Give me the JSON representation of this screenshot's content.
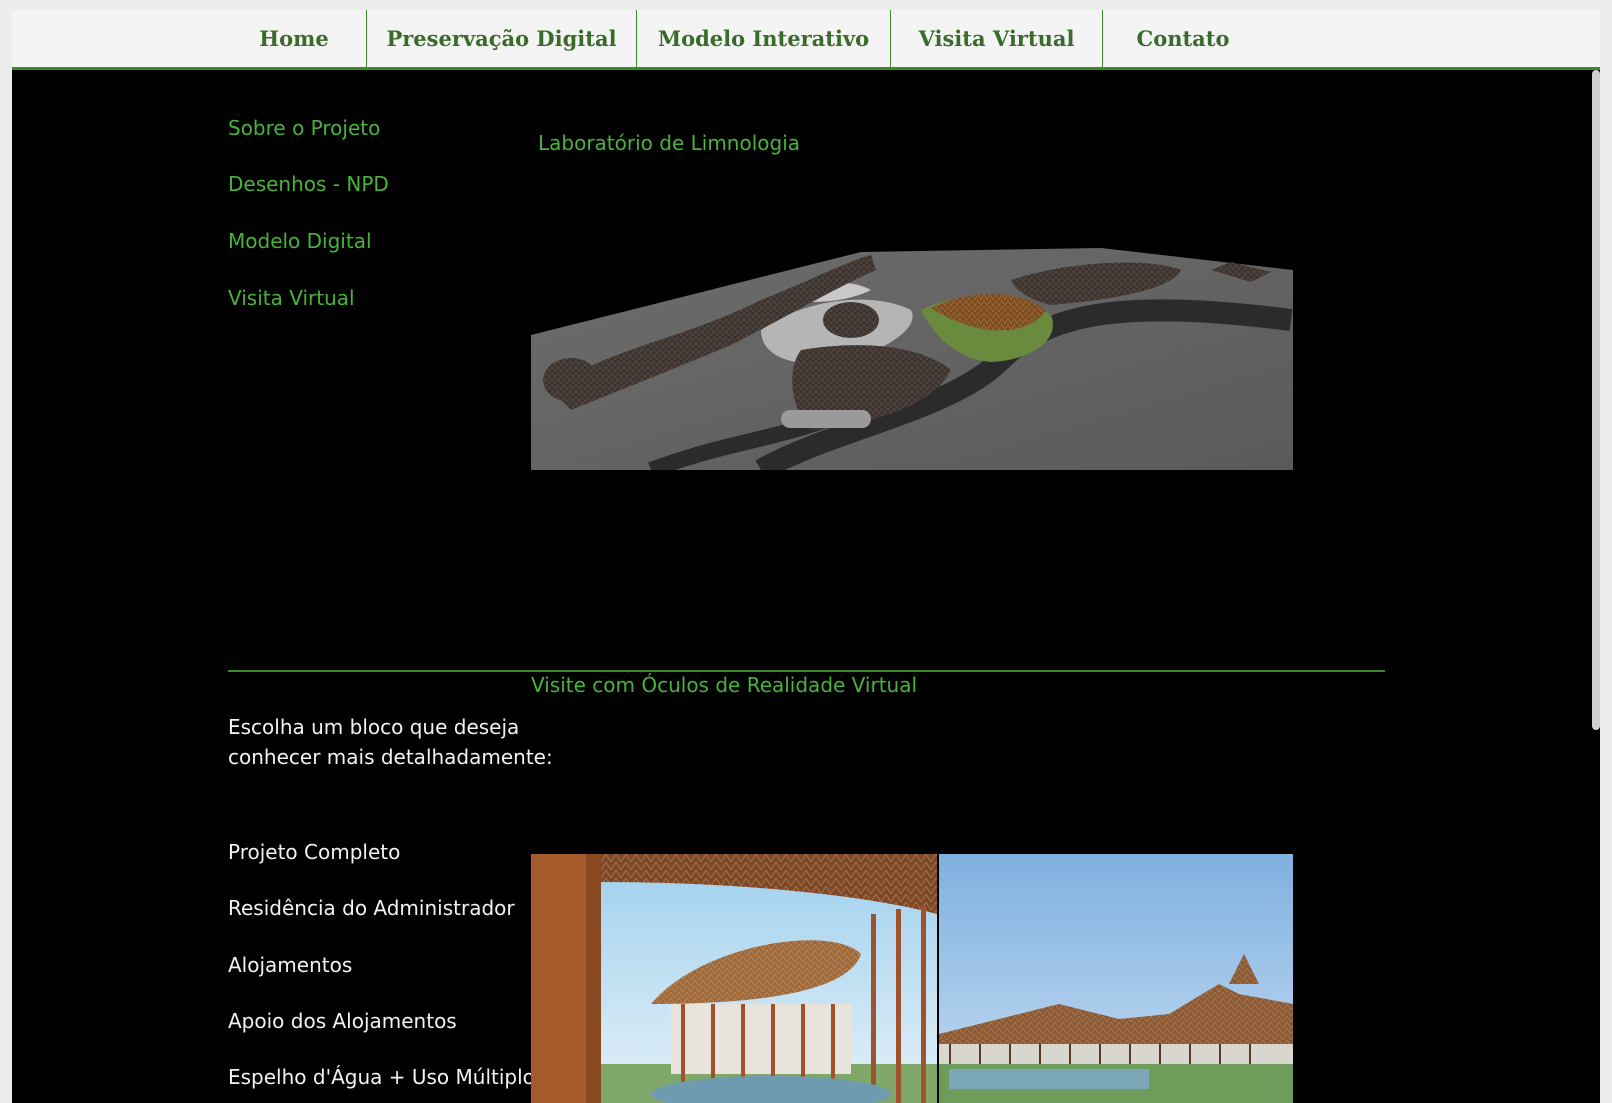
{
  "nav": {
    "items": [
      "Home",
      "Preservação Digital",
      "Modelo Interativo",
      "Visita Virtual",
      "Contato"
    ]
  },
  "sidebar": {
    "links": [
      "Sobre o Projeto",
      "Desenhos - NPD",
      "Modelo Digital",
      "Visita Virtual"
    ]
  },
  "main": {
    "title": "Laboratório de Limnologia",
    "vr_title": "Visite com Óculos de Realidade Virtual",
    "prompt_line1": "Escolha um bloco que deseja",
    "prompt_line2": "conhecer mais detalhadamente:"
  },
  "blocks": {
    "items": [
      "Projeto Completo",
      "Residência do Administrador",
      "Alojamentos",
      "Apoio dos Alojamentos",
      "Espelho d'Água + Uso Múltiplo"
    ]
  },
  "colors": {
    "accent": "#49b33a",
    "nav_text": "#3a6b2c",
    "background": "#000000"
  }
}
